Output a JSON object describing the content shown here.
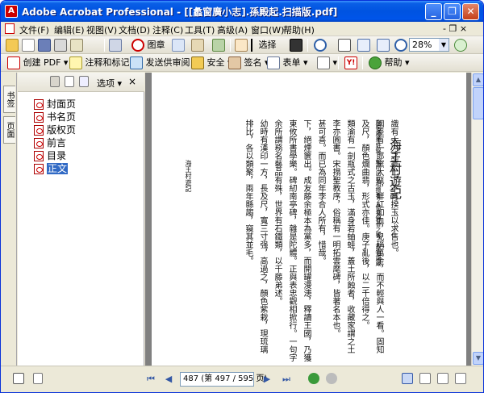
{
  "window": {
    "title": "Adobe Acrobat Professional - [[蠡窗廣小志].孫殿起.扫描版.pdf]",
    "minimize": "_",
    "restore": "❐",
    "close": "✕"
  },
  "menubar": {
    "items": [
      "文件(F)",
      "编辑(E)",
      "视图(V)",
      "文档(D)",
      "注释(C)",
      "工具(T)",
      "高级(A)",
      "窗口(W)",
      "帮助(H)"
    ],
    "right_controls": "- ❐ ×"
  },
  "toolbar1": {
    "print_label": "图章",
    "select_label": "选择",
    "zoom_value": "28%"
  },
  "toolbar2": {
    "create_pdf": "创建 PDF",
    "comment_markup": "注释和标记",
    "send_review": "发送供审阅",
    "secure": "安全",
    "sign": "签名",
    "forms": "表单",
    "help": "帮助"
  },
  "nav": {
    "tabs": [
      "书签",
      "页面"
    ],
    "options_label": "选项",
    "close_glyph": "×",
    "bookmarks": [
      "封面页",
      "书名页",
      "版权页",
      "前言",
      "目录",
      "正文"
    ],
    "selected_index": 5
  },
  "document": {
    "title": "海王村遊記",
    "columns": [
      "海王村遊記",
      "",
      "識有大力之豪士，不肯揆玉以求售也。",
      "國差有一郎窯大甌，鮮紅如血，兒稱萬金，而不輕與人一看。固知",
      "及尺，顏色爛曲翡，形式亦佳。庚子亂後，以二千倍得之。",
      "類渝有一劍瓶式之古玉，滿身若蚰蛙，蓋土所蝕者，收藏家謂之土",
      "李亦圓書。宋搨聖教序，俗稱有一明拓雲麾碑，皆著名本也。",
      "甚可喜。而已為同年李合人所有，惜哉。",
      "下，絕煙篋出。成友藤余極本為黨多，而開罐漫漶，釋讀王國，乃獲",
      "東攸所書學樂。碑紉南亭碑，雜是陀體。正與表忠觀相掀行。一句字",
      "余所謂務名藝品有殊，世界有石鐵類，以千藤弟述。",
      "幼時有漢印一方，長及尺，寬三寸强，高過之，顏色紫栽，現琉璃",
      "排比，各以類聚，兩年縣趨，窺其並毛。",
      "旅宿旅墨蚌錦，賴印出以相攬看，借看錦香之響。故物語蔵"
    ]
  },
  "statusbar": {
    "page_display": "487 (第 497 / 595 页)",
    "first": "⏮",
    "prev": "◀",
    "next": "▶",
    "last": "⏭"
  }
}
